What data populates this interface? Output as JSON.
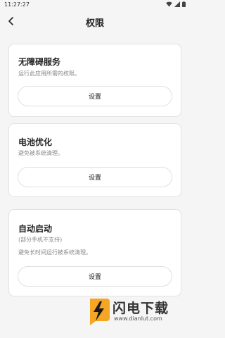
{
  "status_bar": {
    "time": "11:27:27"
  },
  "header": {
    "title": "权限"
  },
  "cards": [
    {
      "title": "无障碍服务",
      "desc": "运行此应用所需的权限。",
      "button": "设置"
    },
    {
      "title": "电池优化",
      "desc": "避免被系统清理。",
      "button": "设置"
    },
    {
      "title": "自动启动",
      "desc": "(部分手机不支持)",
      "desc2": "避免长时间运行被系统清理。",
      "button": "设置"
    }
  ],
  "watermark": {
    "text": "闪电下载",
    "url": "www.dianlut.com"
  }
}
